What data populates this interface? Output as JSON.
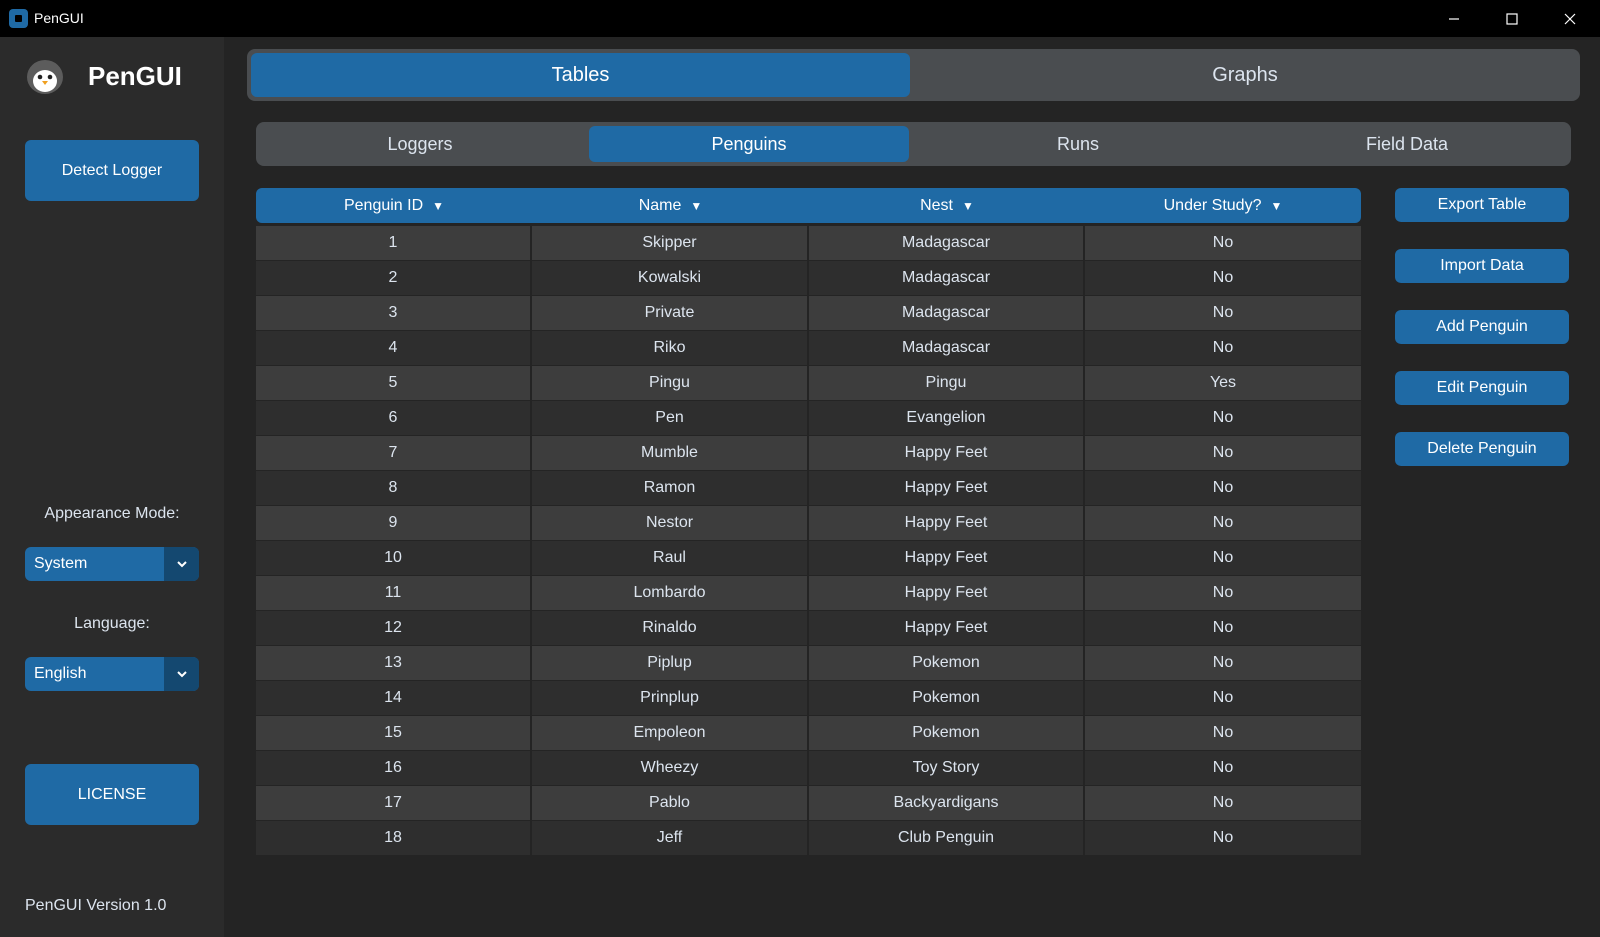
{
  "window": {
    "title": "PenGUI",
    "minimize_icon": "minimize-icon",
    "maximize_icon": "maximize-icon",
    "close_icon": "close-icon"
  },
  "sidebar": {
    "app_name": "PenGUI",
    "logo_icon": "penguin-icon",
    "detect_logger_label": "Detect Logger",
    "appearance_label": "Appearance Mode:",
    "appearance_value": "System",
    "language_label": "Language:",
    "language_value": "English",
    "license_label": "LICENSE",
    "version": "PenGUI Version 1.0"
  },
  "main_tabs": [
    {
      "label": "Tables",
      "active": true
    },
    {
      "label": "Graphs",
      "active": false
    }
  ],
  "sub_tabs": [
    {
      "label": "Loggers",
      "active": false
    },
    {
      "label": "Penguins",
      "active": true
    },
    {
      "label": "Runs",
      "active": false
    },
    {
      "label": "Field Data",
      "active": false
    }
  ],
  "table": {
    "columns": [
      "Penguin ID",
      "Name",
      "Nest",
      "Under Study?"
    ],
    "sort_icon": "▼",
    "rows": [
      [
        "1",
        "Skipper",
        "Madagascar",
        "No"
      ],
      [
        "2",
        "Kowalski",
        "Madagascar",
        "No"
      ],
      [
        "3",
        "Private",
        "Madagascar",
        "No"
      ],
      [
        "4",
        "Riko",
        "Madagascar",
        "No"
      ],
      [
        "5",
        "Pingu",
        "Pingu",
        "Yes"
      ],
      [
        "6",
        "Pen",
        "Evangelion",
        "No"
      ],
      [
        "7",
        "Mumble",
        "Happy Feet",
        "No"
      ],
      [
        "8",
        "Ramon",
        "Happy Feet",
        "No"
      ],
      [
        "9",
        "Nestor",
        "Happy Feet",
        "No"
      ],
      [
        "10",
        "Raul",
        "Happy Feet",
        "No"
      ],
      [
        "11",
        "Lombardo",
        "Happy Feet",
        "No"
      ],
      [
        "12",
        "Rinaldo",
        "Happy Feet",
        "No"
      ],
      [
        "13",
        "Piplup",
        "Pokemon",
        "No"
      ],
      [
        "14",
        "Prinplup",
        "Pokemon",
        "No"
      ],
      [
        "15",
        "Empoleon",
        "Pokemon",
        "No"
      ],
      [
        "16",
        "Wheezy",
        "Toy Story",
        "No"
      ],
      [
        "17",
        "Pablo",
        "Backyardigans",
        "No"
      ],
      [
        "18",
        "Jeff",
        "Club Penguin",
        "No"
      ]
    ]
  },
  "actions": [
    "Export Table",
    "Import Data",
    "Add Penguin",
    "Edit Penguin",
    "Delete Penguin"
  ],
  "colors": {
    "accent": "#1f6aa5",
    "accent_dark": "#144870",
    "background": "#242424",
    "sidebar": "#2b2b2b",
    "segment_bg": "#4a4d50",
    "row_light": "#3d3d3d",
    "row_dark": "#2e2e2e"
  }
}
